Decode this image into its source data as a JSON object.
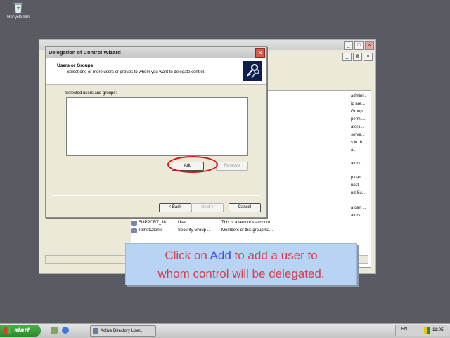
{
  "desktop": {
    "recycle_bin_label": "Recycle Bin"
  },
  "background_window": {
    "list_fragments": [
      "admini...",
      "ip are...",
      "Group",
      "permi...",
      "ators...",
      "serve...",
      "s in th...",
      "a...",
      "ators...",
      "p can...",
      "uest...",
      "nd Su...",
      "a can ...",
      "ators..."
    ],
    "rows": [
      {
        "name": "SUPPORT_38...",
        "type": "User",
        "description": "This is a vendor's account ..."
      },
      {
        "name": "TelnetClients",
        "type": "Security Group ...",
        "description": "Members of this group ha..."
      }
    ]
  },
  "dialog": {
    "title": "Delegation of Control Wizard",
    "header_title": "Users or Groups",
    "header_subtitle": "Select one or more users or groups to whom you want to delegate control.",
    "selected_label": "Selected users and groups:",
    "add_label": "Add",
    "remove_label": "Remove",
    "back_label": "< Back",
    "next_label": "Next >",
    "cancel_label": "Cancel"
  },
  "callout": {
    "text_before": "Click on ",
    "highlight": "Add",
    "text_after": " to add a user to",
    "line2": "whom control will be delegated."
  },
  "taskbar": {
    "start_label": "start",
    "task_label": "Active Directory User...",
    "language": "EN",
    "clock": "11:05"
  },
  "colors": {
    "callout_background": "#b8d4f5",
    "callout_text": "#d2404f",
    "callout_highlight": "#3f4ee0",
    "annotation_oval": "#d3121a"
  }
}
